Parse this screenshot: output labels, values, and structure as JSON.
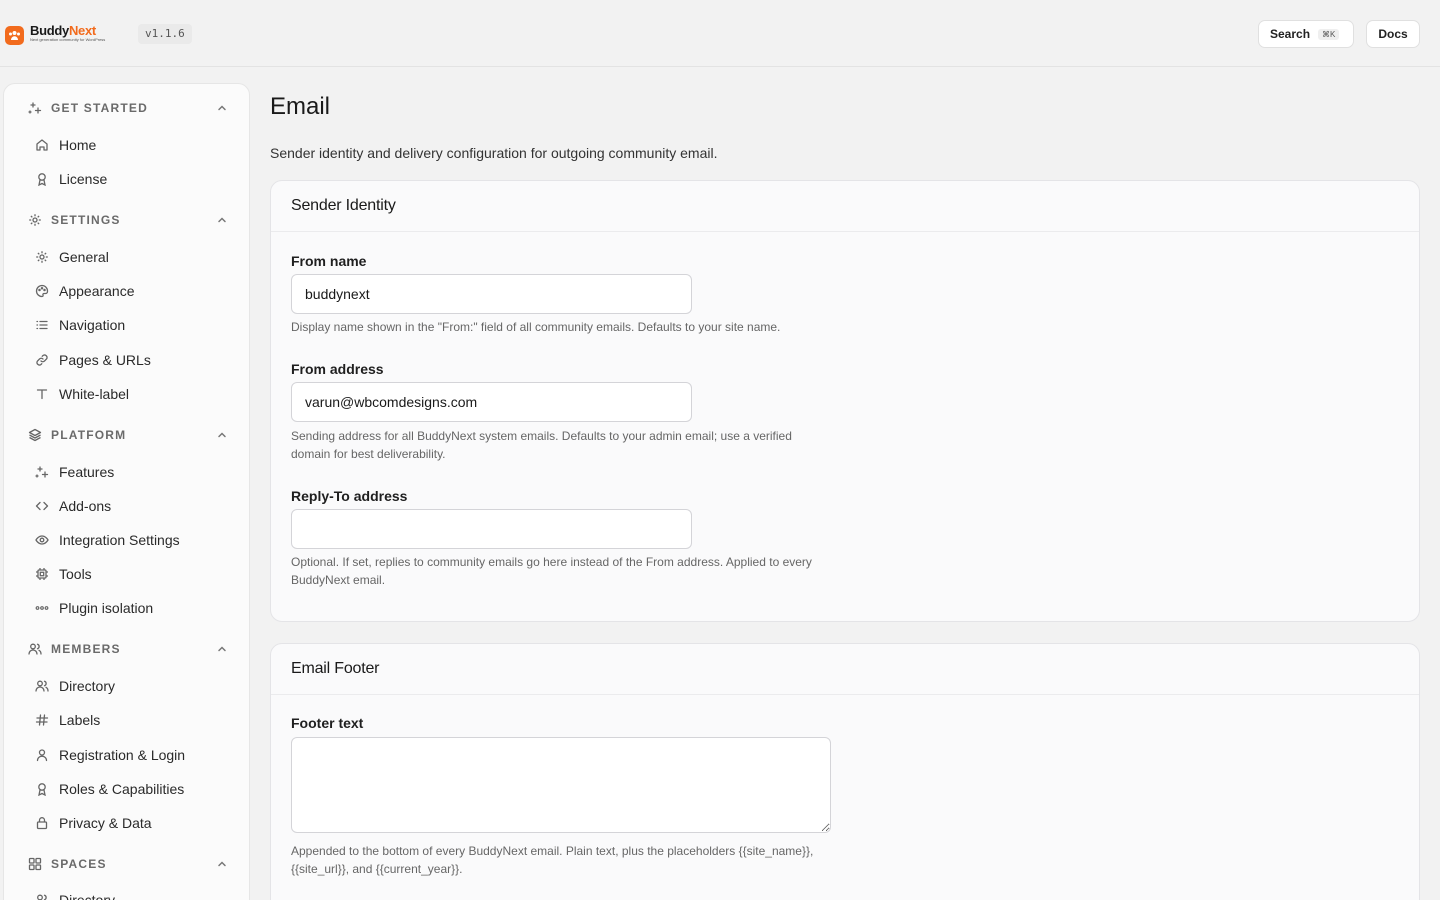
{
  "brand": {
    "name_main": "Buddy",
    "name_accent": "Next",
    "tagline": "Next generation community for WordPress",
    "version": "v1.1.6",
    "accent_color": "#f26b1d"
  },
  "topbar": {
    "search_label": "Search",
    "search_shortcut": "⌘K",
    "docs_label": "Docs"
  },
  "sidebar": {
    "sections": [
      {
        "title": "GET STARTED",
        "icon": "sparkles-icon",
        "items": [
          {
            "label": "Home",
            "icon": "home-icon"
          },
          {
            "label": "License",
            "icon": "award-icon"
          }
        ]
      },
      {
        "title": "SETTINGS",
        "icon": "gear-icon",
        "items": [
          {
            "label": "General",
            "icon": "gear-icon"
          },
          {
            "label": "Appearance",
            "icon": "palette-icon"
          },
          {
            "label": "Navigation",
            "icon": "list-icon"
          },
          {
            "label": "Pages & URLs",
            "icon": "link-icon"
          },
          {
            "label": "White-label",
            "icon": "type-icon"
          }
        ]
      },
      {
        "title": "PLATFORM",
        "icon": "layers-icon",
        "items": [
          {
            "label": "Features",
            "icon": "sparkles-icon"
          },
          {
            "label": "Add-ons",
            "icon": "code-icon"
          },
          {
            "label": "Integration Settings",
            "icon": "eye-icon"
          },
          {
            "label": "Tools",
            "icon": "cpu-icon"
          },
          {
            "label": "Plugin isolation",
            "icon": "dots-icon"
          }
        ]
      },
      {
        "title": "MEMBERS",
        "icon": "users-icon",
        "items": [
          {
            "label": "Directory",
            "icon": "users-icon"
          },
          {
            "label": "Labels",
            "icon": "hash-icon"
          },
          {
            "label": "Registration & Login",
            "icon": "user-icon"
          },
          {
            "label": "Roles & Capabilities",
            "icon": "award-icon"
          },
          {
            "label": "Privacy & Data",
            "icon": "lock-icon"
          }
        ]
      },
      {
        "title": "SPACES",
        "icon": "grid-icon",
        "items": [
          {
            "label": "Directory",
            "icon": "users-icon"
          }
        ]
      }
    ]
  },
  "main": {
    "title": "Email",
    "description": "Sender identity and delivery configuration for outgoing community email.",
    "sender_card": {
      "title": "Sender Identity",
      "from_name": {
        "label": "From name",
        "value": "buddynext",
        "help": "Display name shown in the \"From:\" field of all community emails. Defaults to your site name."
      },
      "from_address": {
        "label": "From address",
        "value": "varun@wbcomdesigns.com",
        "help": "Sending address for all BuddyNext system emails. Defaults to your admin email; use a verified domain for best deliverability."
      },
      "reply_to": {
        "label": "Reply-To address",
        "value": "",
        "help": "Optional. If set, replies to community emails go here instead of the From address. Applied to every BuddyNext email."
      }
    },
    "footer_card": {
      "title": "Email Footer",
      "footer_text": {
        "label": "Footer text",
        "value": "",
        "help": "Appended to the bottom of every BuddyNext email. Plain text, plus the placeholders {{site_name}}, {{site_url}}, and {{current_year}}."
      }
    }
  }
}
